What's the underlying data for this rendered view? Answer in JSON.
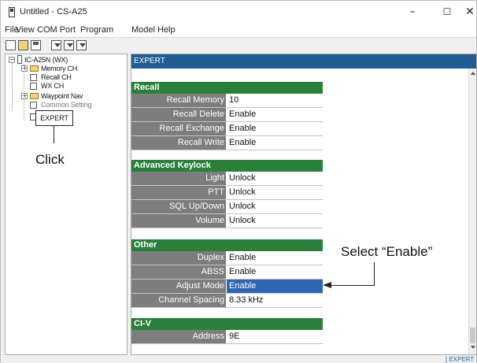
{
  "window": {
    "title": "Untitled - CS-A25",
    "min_icon": "minimize-icon",
    "max_icon": "maximize-icon",
    "close_icon": "close-icon"
  },
  "menu": [
    "File",
    "View",
    "COM Port",
    "Program",
    "Model",
    "Help"
  ],
  "toolbar": {
    "icons": [
      "new-file-icon",
      "open-folder-icon",
      "save-icon",
      "read-from-radio-icon",
      "write-to-radio-icon",
      "clone-icon"
    ]
  },
  "tree": {
    "root": "IC-A25N (WX)",
    "items": [
      "Memory CH",
      "Recall CH",
      "WX CH",
      "Waypoint Nav",
      "Common Setting"
    ],
    "selected": "EXPERT"
  },
  "annotations": {
    "click": "Click",
    "select": "Select “Enable”"
  },
  "panel": {
    "header": "EXPERT",
    "sections": [
      {
        "title": "Recall",
        "rows": [
          {
            "label": "Recall Memory",
            "value": "10"
          },
          {
            "label": "Recall Delete",
            "value": "Enable"
          },
          {
            "label": "Recall Exchange",
            "value": "Enable"
          },
          {
            "label": "Recall Write",
            "value": "Enable"
          }
        ]
      },
      {
        "title": "Advanced Keylock",
        "rows": [
          {
            "label": "Light",
            "value": "Unlock"
          },
          {
            "label": "PTT",
            "value": "Unlock"
          },
          {
            "label": "SQL Up/Down",
            "value": "Unlock"
          },
          {
            "label": "Volume",
            "value": "Unlock"
          }
        ]
      },
      {
        "title": "Other",
        "rows": [
          {
            "label": "Duplex",
            "value": "Enable"
          },
          {
            "label": "ABSS",
            "value": "Enable"
          },
          {
            "label": "Adjust Mode",
            "value": "Enable"
          },
          {
            "label": "Channel Spacing",
            "value": "8.33 kHz"
          }
        ]
      },
      {
        "title": "CI-V",
        "rows": [
          {
            "label": "Address",
            "value": "9E"
          }
        ]
      }
    ]
  },
  "status": {
    "mode": "[ EXPERT ]"
  },
  "colors": {
    "panel_header": "#1f5d93",
    "section_header": "#2a7f3a",
    "label_bg": "#7d7d7d",
    "selected_value": "#2f66b3"
  }
}
